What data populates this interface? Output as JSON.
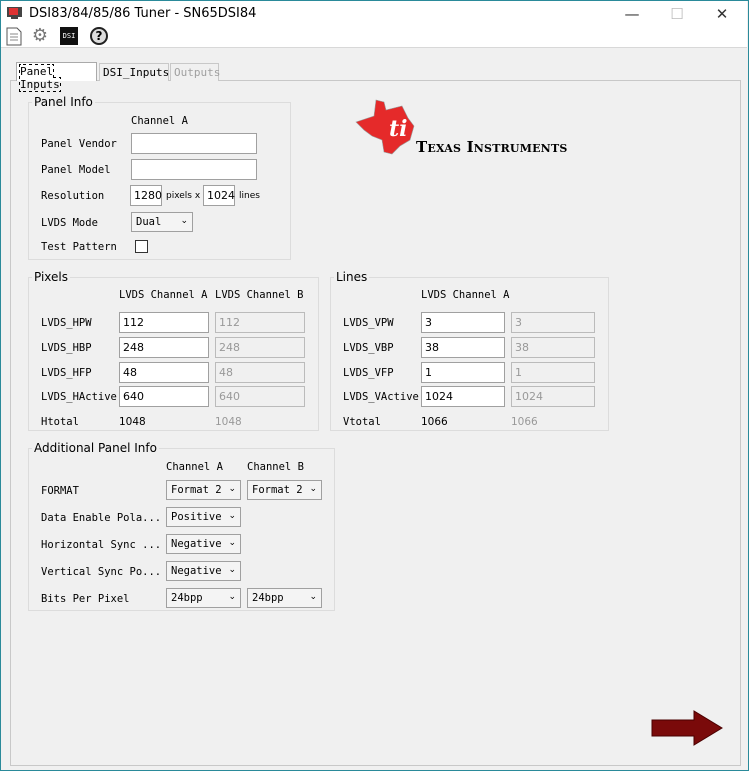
{
  "window": {
    "title": "DSI83/84/85/86 Tuner - SN65DSI84"
  },
  "toolbar": {
    "icons": [
      "document-icon",
      "gear-icon",
      "dsi-icon",
      "help-icon"
    ],
    "dsi_label": "DSI"
  },
  "tabs": [
    {
      "label": "Panel Inputs",
      "state": "active"
    },
    {
      "label": "DSI_Inputs",
      "state": "normal"
    },
    {
      "label": "Outputs",
      "state": "disabled"
    }
  ],
  "logo": {
    "text": "Texas Instruments",
    "color": "#e52a2a"
  },
  "panel_info": {
    "title": "Panel Info",
    "column_header": "Channel A",
    "vendor_label": "Panel Vendor",
    "vendor_value": "",
    "model_label": "Panel Model",
    "model_value": "",
    "resolution_label": "Resolution",
    "res_w": "1280",
    "pixels_x": "pixels x",
    "res_h": "1024",
    "lines": "lines",
    "lvds_mode_label": "LVDS Mode",
    "lvds_mode_value": "Dual",
    "test_pattern_label": "Test Pattern",
    "test_pattern_checked": false
  },
  "pixels": {
    "title": "Pixels",
    "headers": [
      "LVDS Channel A",
      "LVDS Channel B"
    ],
    "rows": [
      {
        "label": "LVDS_HPW",
        "a": "112",
        "b": "112"
      },
      {
        "label": "LVDS_HBP",
        "a": "248",
        "b": "248"
      },
      {
        "label": "LVDS_HFP",
        "a": "48",
        "b": "48"
      },
      {
        "label": "LVDS_HActive",
        "a": "640",
        "b": "640"
      }
    ],
    "total_label": "Htotal",
    "total_a": "1048",
    "total_b": "1048"
  },
  "lines": {
    "title": "Lines",
    "header": "LVDS Channel A",
    "rows": [
      {
        "label": "LVDS_VPW",
        "a": "3",
        "b": "3"
      },
      {
        "label": "LVDS_VBP",
        "a": "38",
        "b": "38"
      },
      {
        "label": "LVDS_VFP",
        "a": "1",
        "b": "1"
      },
      {
        "label": "LVDS_VActive",
        "a": "1024",
        "b": "1024"
      }
    ],
    "total_label": "Vtotal",
    "total_a": "1066",
    "total_b": "1066"
  },
  "additional": {
    "title": "Additional Panel Info",
    "headers": [
      "Channel A",
      "Channel B"
    ],
    "rows": [
      {
        "label": "FORMAT",
        "a": "Format 2",
        "b": "Format 2"
      },
      {
        "label": "Data Enable Pola...",
        "a": "Positive"
      },
      {
        "label": "Horizontal Sync ...",
        "a": "Negative"
      },
      {
        "label": "Vertical Sync Po...",
        "a": "Negative"
      },
      {
        "label": "Bits Per Pixel",
        "a": "24bpp",
        "b": "24bpp"
      }
    ]
  },
  "next_arrow_color": "#7a0a0a"
}
